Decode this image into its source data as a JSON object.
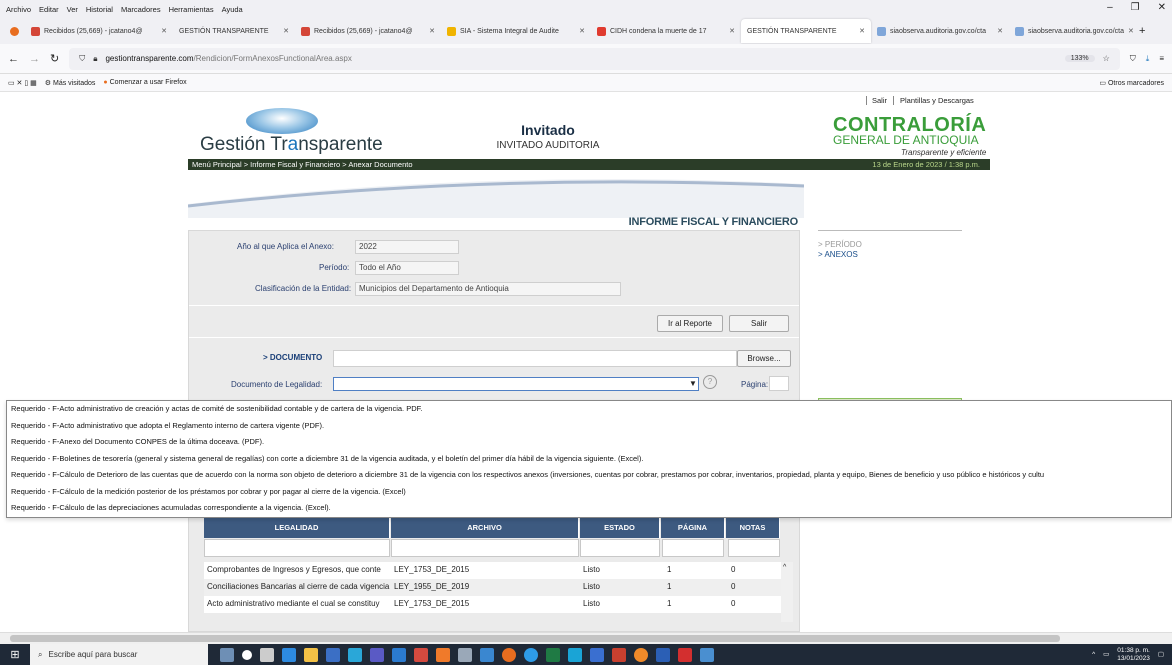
{
  "menu": [
    "Archivo",
    "Editar",
    "Ver",
    "Historial",
    "Marcadores",
    "Herramientas",
    "Ayuda"
  ],
  "window_controls": [
    "–",
    "❐",
    "✕"
  ],
  "tabs": [
    {
      "label": "Recibidos (25,669) - jcatano4@",
      "color": "#d44638"
    },
    {
      "label": "GESTIÓN TRANSPARENTE",
      "color": "#ffffff"
    },
    {
      "label": "Recibidos (25,669) - jcatano4@",
      "color": "#d44638"
    },
    {
      "label": "SIA - Sistema Integral de Audite",
      "color": "#f0b400"
    },
    {
      "label": "CIDH condena la muerte de 17",
      "color": "#e03b2f"
    },
    {
      "label": "GESTIÓN TRANSPARENTE",
      "color": "#ffffff",
      "active": true
    },
    {
      "label": "siaobserva.auditoria.gov.co/cta",
      "color": "#7fa6d9"
    },
    {
      "label": "siaobserva.auditoria.gov.co/cta",
      "color": "#7fa6d9"
    }
  ],
  "url": {
    "host": "gestiontransparente.com",
    "path": "/Rendicion/FormAnexosFunctionalArea.aspx",
    "zoom": "133%"
  },
  "bookmarks": {
    "most_visited": "Más visitados",
    "firefox": "Comenzar a usar Firefox",
    "others": "Otros marcadores"
  },
  "header": {
    "links": [
      "Salir",
      "Plantillas y Descargas"
    ],
    "brand_left": {
      "part1": "Gestión Tr",
      "part2": "a",
      "part3": "nsparente"
    },
    "user": "Invitado",
    "user_role": "INVITADO AUDITORIA",
    "brand_right": {
      "line1": "CONTRALORÍA",
      "line2": "GENERAL DE ANTIOQUIA",
      "tagline": "Transparente y eficiente"
    },
    "breadcrumb": "Menú Principal  >  Informe Fiscal y Financiero  >  Anexar Documento",
    "date": "13 de Enero de 2023 / 1:38 p.m."
  },
  "report_title": "INFORME FISCAL Y FINANCIERO",
  "form": {
    "anio_label": "Año al que Aplica el Anexo:",
    "anio_value": "2022",
    "periodo_label": "Período:",
    "periodo_value": "Todo el Año",
    "clasif_label": "Clasificación de la Entidad:",
    "clasif_value": "Municipios del Departamento de Antioquia",
    "btn_report": "Ir al Reporte",
    "btn_exit": "Salir",
    "documento_label": "> DOCUMENTO",
    "browse": "Browse...",
    "legal_label": "Documento de Legalidad:",
    "pagina_label": "Página:"
  },
  "sidenav": {
    "periodo": "> PERÍODO",
    "anexos": "> ANEXOS"
  },
  "dropdown_options": [
    "Requerido - F-Acto administrativo de creación y actas de comité de sostenibilidad contable y de cartera de la vigencia. PDF.",
    "Requerido - F-Acto administrativo que adopta el Reglamento interno de cartera vigente (PDF).",
    "Requerido - F-Anexo del Documento CONPES de la última doceava. (PDF).",
    "Requerido - F-Boletines de tesorería (general y sistema general de regalías) con corte a diciembre 31 de la vigencia auditada, y el boletín del primer día hábil de la vigencia siguiente. (Excel).",
    "Requerido - F-Cálculo de Deterioro de las cuentas que de acuerdo con la norma son objeto de deterioro a diciembre 31 de la vigencia con los respectivos anexos (inversiones, cuentas por cobrar, prestamos por cobrar, inventarios, propiedad, planta y equipo, Bienes de beneficio y uso público e históricos y cultu",
    "Requerido - F-Cálculo de la medición posterior de los préstamos por cobrar y por pagar al cierre de la vigencia. (Excel)",
    "Requerido - F-Cálculo de las depreciaciones acumuladas correspondiente a la vigencia. (Excel)."
  ],
  "table": {
    "headers": [
      "LEGALIDAD",
      "ARCHIVO",
      "ESTADO",
      "PÁGINA",
      "NOTAS"
    ],
    "rows": [
      [
        "Comprobantes de Ingresos y Egresos, que conte",
        "LEY_1753_DE_2015",
        "Listo",
        "1",
        "0"
      ],
      [
        "Conciliaciones Bancarias al cierre de cada vigencia",
        "LEY_1955_DE_2019",
        "Listo",
        "1",
        "0"
      ],
      [
        "Acto administrativo mediante el cual se constituy",
        "LEY_1753_DE_2015",
        "Listo",
        "1",
        "0"
      ]
    ]
  },
  "taskbar": {
    "search": "Escribe aquí para buscar",
    "time": "01:38 p. m.",
    "date": "13/01/2023"
  }
}
